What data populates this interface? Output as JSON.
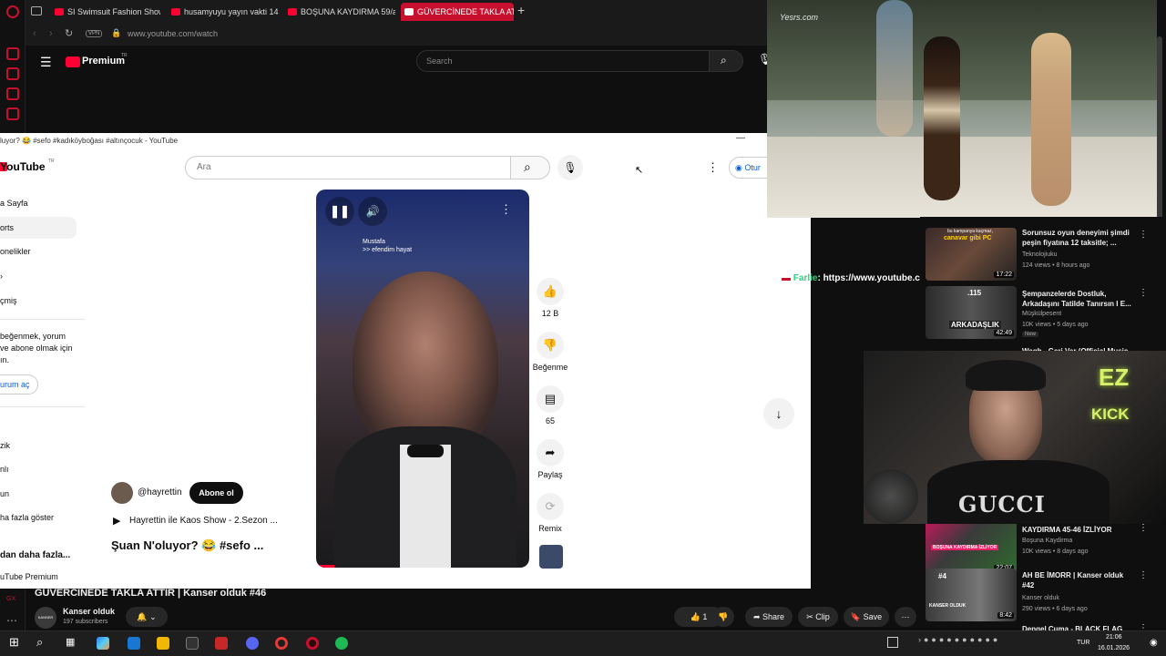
{
  "browser": {
    "tabs": [
      {
        "label": "SI Swimsuit Fashion Show"
      },
      {
        "label": "husamyuyu yayın vakti 14"
      },
      {
        "label": "BOŞUNA KAYDIRMA 59/a"
      },
      {
        "label": "GÜVERCİNEDE TAKLA ATT"
      }
    ],
    "vpn_label": "VPN",
    "url": "www.youtube.com/watch",
    "new_tab": "+"
  },
  "back_page": {
    "logo_label": "Premium",
    "logo_sup": "TR",
    "search_placeholder": "Search",
    "video_title": "GÜVERCİNEDE TAKLA ATTIR | Kanser olduk #46",
    "channel_name": "Kanser olduk",
    "subscribers": "197 subscribers",
    "avatar_label": "KANSER OLDUK",
    "likes": "1",
    "share_label": "Share",
    "clip_label": "Clip",
    "save_label": "Save"
  },
  "front_window": {
    "title": "luyor? 😂 #sefo #kadıköyboğası #altınçocuk - YouTube",
    "logo_label": "YouTube",
    "logo_sup": "TR",
    "search_placeholder": "Ara",
    "signin_label": "Otur",
    "sidebar": {
      "items": [
        "a Sayfa",
        "orts",
        "onelikler",
        "çmiş"
      ],
      "signin_prompt": [
        "beğenmek, yorum",
        "ve abone olmak için",
        "ın."
      ],
      "signin_button": "urum aç",
      "explore": [
        "zik",
        "nlı",
        "un",
        "ha fazla göster"
      ],
      "more_from": "dan daha fazla...",
      "premium": "uTube Premium"
    },
    "short": {
      "caption_name": "Mustafa",
      "caption_text": ">> efendim hayat",
      "channel": "@hayrettin",
      "subscribe_label": "Abone ol",
      "playlist": "Hayrettin ile Kaos Show - 2.Sezon ...",
      "title": "Şuan N'oluyor? 😂 #sefo ..."
    },
    "actions": {
      "like_count": "12 B",
      "dislike_label": "Beğenme",
      "comment_count": "65",
      "share_label": "Paylaş",
      "remix_label": "Remix"
    }
  },
  "overlay": {
    "watermark": "Yesrs.com"
  },
  "chat_message": {
    "user": "Farlie",
    "text": ": https://www.youtube.com/shorts/wXsQIzBUCQ"
  },
  "webcam": {
    "neon_top": "EZ",
    "neon_bottom": "KICK",
    "shirt_text": "GUCCI"
  },
  "recommendations": [
    {
      "title": "Sorunsuz oyun deneyimi şimdi peşin fiyatına 12 taksitle; ...",
      "channel": "Teknolojiuku",
      "meta": "124 views • 8 hours ago",
      "duration": "17:22",
      "thumb_text_top": "bu kampanya kaçmaz,",
      "thumb_text": "canavar gibi PC",
      "badge": ""
    },
    {
      "title": "Şempanzelerde Dostluk, Arkadaşını Tatilde Tanırsın I E...",
      "channel": "Müşkülpesent",
      "meta": "10K views • 5 days ago",
      "duration": "42:49",
      "thumb_text_top": ".115",
      "thumb_text": "ARKADAŞLIK",
      "badge": "New"
    },
    {
      "title": "Wegh - Geri Ver (Official Music",
      "channel": "",
      "meta": "",
      "duration": "",
      "thumb_text_top": "",
      "thumb_text": "",
      "badge": ""
    },
    {
      "title": "KAYDIRMA 45-46 İZLİYOR",
      "channel": "Boşuna Kaydirma",
      "meta": "10K views • 8 days ago",
      "duration": "22:07",
      "thumb_text_top": "",
      "thumb_text": "BOŞUNA KAYDIRMA İZLİYOR",
      "badge": ""
    },
    {
      "title": "AH BE İMORR | Kanser olduk #42",
      "channel": "Kanser olduk",
      "meta": "290 views • 6 days ago",
      "duration": "8:42",
      "thumb_text_top": "#4",
      "thumb_text": "KANSER OLDUK",
      "badge": ""
    },
    {
      "title": "Dengel Cuma - BLACK FLAG",
      "channel": "",
      "meta": "",
      "duration": "",
      "thumb_text_top": "",
      "thumb_text": "",
      "badge": ""
    }
  ],
  "taskbar": {
    "lang": "TUR",
    "time": "21:06",
    "date": "16.01.2026"
  }
}
